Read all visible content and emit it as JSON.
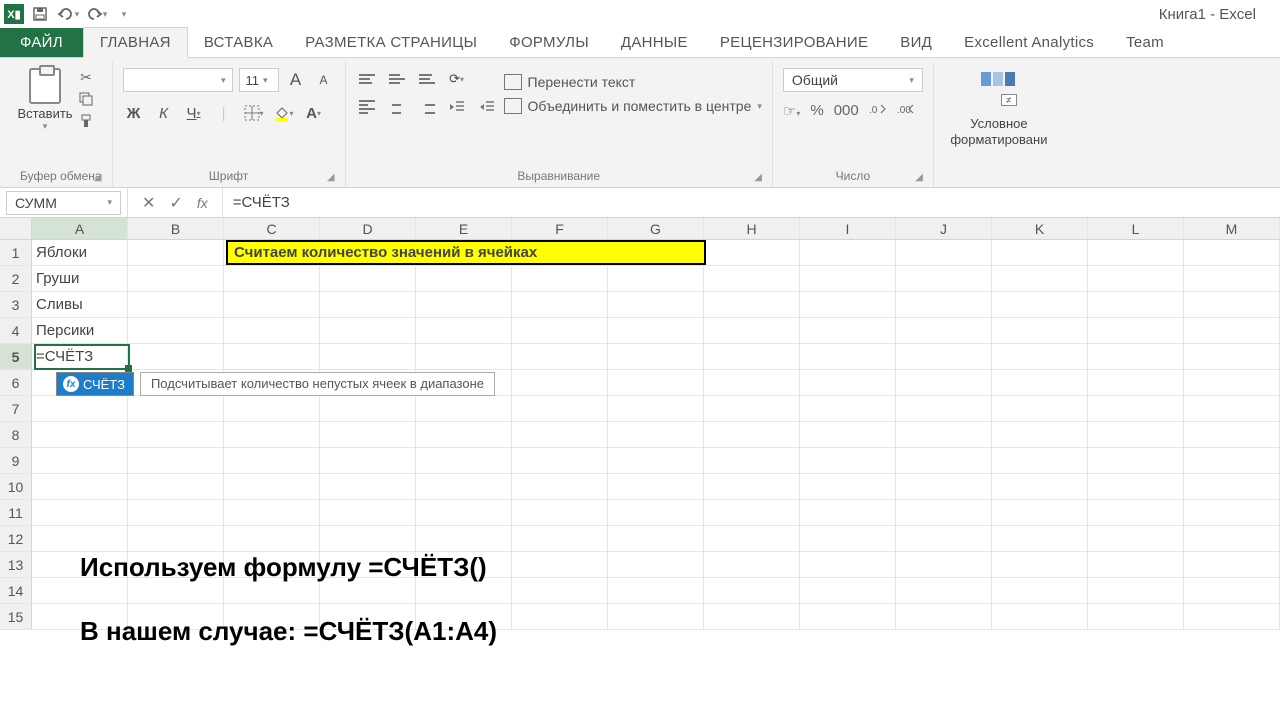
{
  "title": "Книга1 - Excel",
  "qat": {
    "excel_glyph": "X▮"
  },
  "tabs": {
    "file": "ФАЙЛ",
    "items": [
      "ГЛАВНАЯ",
      "ВСТАВКА",
      "РАЗМЕТКА СТРАНИЦЫ",
      "ФОРМУЛЫ",
      "ДАННЫЕ",
      "РЕЦЕНЗИРОВАНИЕ",
      "ВИД",
      "Excellent Analytics",
      "Team"
    ],
    "active_index": 0
  },
  "ribbon": {
    "clipboard": {
      "paste": "Вставить",
      "label": "Буфер обмена"
    },
    "font": {
      "size": "11",
      "label": "Шрифт",
      "bold": "Ж",
      "italic": "К",
      "underline": "Ч",
      "a_big": "A",
      "a_small": "A"
    },
    "alignment": {
      "wrap": "Перенести текст",
      "merge": "Объединить и поместить в центре",
      "label": "Выравнивание"
    },
    "number": {
      "format": "Общий",
      "label": "Число",
      "percent": "%",
      "comma": "000"
    },
    "cond": {
      "label": "Условное форматировани"
    }
  },
  "formula_bar": {
    "name": "СУММ",
    "formula": "=СЧЁТЗ",
    "fx": "fx"
  },
  "columns": [
    "A",
    "B",
    "C",
    "D",
    "E",
    "F",
    "G",
    "H",
    "I",
    "J",
    "K",
    "L",
    "M"
  ],
  "row_count": 15,
  "cells": {
    "A1": "Яблоки",
    "A2": "Груши",
    "A3": "Сливы",
    "A4": "Персики",
    "A5": "=СЧЁТЗ"
  },
  "banner": "Считаем количество значений в ячейках",
  "tooltip": {
    "func": "СЧЁТЗ",
    "desc": "Подсчитывает количество непустых ячеек в диапазоне"
  },
  "annotations": {
    "line1": "Используем формулу =СЧЁТЗ()",
    "line2": "В нашем случае: =СЧЁТЗ(A1:A4)"
  }
}
